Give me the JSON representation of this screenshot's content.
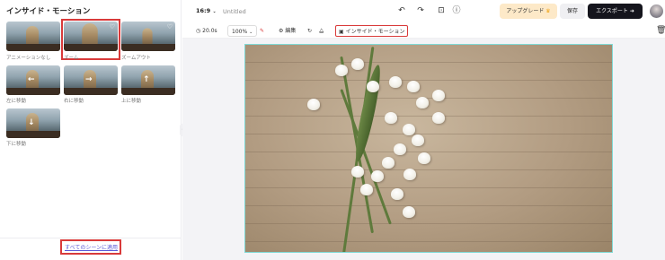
{
  "panel": {
    "title": "インサイド・モーション",
    "apply_all": "すべてのシーンに適用",
    "items": [
      {
        "label": "アニメーションなし",
        "icon": "none"
      },
      {
        "label": "ズーム",
        "icon": "zoom"
      },
      {
        "label": "ズームアウト",
        "icon": "zoom-out"
      },
      {
        "label": "左に移動",
        "icon": "arrow-left"
      },
      {
        "label": "右に移動",
        "icon": "arrow-right"
      },
      {
        "label": "上に移動",
        "icon": "arrow-up"
      },
      {
        "label": "下に移動",
        "icon": "arrow-down"
      }
    ],
    "selected_item": "ズーム"
  },
  "topbar": {
    "aspect_ratio": "16:9",
    "doc_title": "Untitled",
    "upgrade_label": "アップグレード",
    "save_label": "保存",
    "export_label": "エクスポート"
  },
  "toolbar": {
    "duration": "20.0s",
    "zoom": "100%",
    "edit_label": "編集",
    "motion_label": "インサイド・モーション"
  },
  "colors": {
    "accent_red": "#d93a3a",
    "export_bg": "#15151d",
    "upgrade_bg": "#fde9c8",
    "canvas_border": "#7fd9d5"
  }
}
